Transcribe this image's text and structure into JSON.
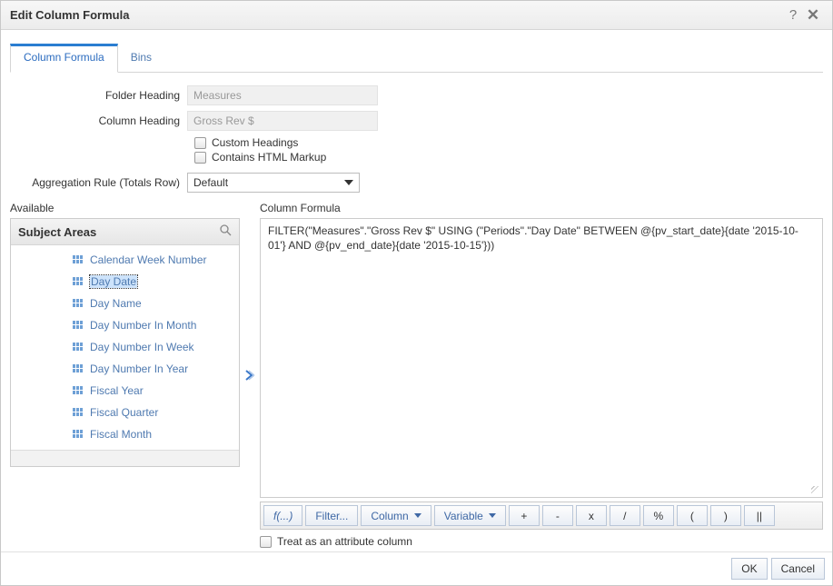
{
  "title": "Edit Column Formula",
  "tabs": [
    {
      "label": "Column Formula",
      "active": true
    },
    {
      "label": "Bins",
      "active": false
    }
  ],
  "form": {
    "folder_heading_label": "Folder Heading",
    "folder_heading_value": "Measures",
    "column_heading_label": "Column Heading",
    "column_heading_value": "Gross Rev $",
    "custom_headings_label": "Custom Headings",
    "contains_html_label": "Contains HTML Markup",
    "aggregation_label": "Aggregation Rule (Totals Row)",
    "aggregation_value": "Default"
  },
  "available_label": "Available",
  "subject_areas_label": "Subject Areas",
  "tree_items": [
    {
      "label": "Calendar Week Number",
      "selected": false
    },
    {
      "label": "Day Date",
      "selected": true
    },
    {
      "label": "Day Name",
      "selected": false
    },
    {
      "label": "Day Number In Month",
      "selected": false
    },
    {
      "label": "Day Number In Week",
      "selected": false
    },
    {
      "label": "Day Number In Year",
      "selected": false
    },
    {
      "label": "Fiscal Year",
      "selected": false
    },
    {
      "label": "Fiscal Quarter",
      "selected": false
    },
    {
      "label": "Fiscal Month",
      "selected": false
    }
  ],
  "column_formula_label": "Column Formula",
  "column_formula_value": "FILTER(\"Measures\".\"Gross Rev $\" USING (\"Periods\".\"Day Date\" BETWEEN @{pv_start_date}{date '2015-10-01'} AND @{pv_end_date}{date '2015-10-15'}))",
  "toolbar": {
    "fx": "f(...)",
    "filter": "Filter...",
    "column": "Column",
    "variable": "Variable",
    "plus": "+",
    "minus": "-",
    "mult": "x",
    "div": "/",
    "pct": "%",
    "lparen": "(",
    "rparen": ")",
    "concat": "||"
  },
  "treat_label": "Treat as an attribute column",
  "footer": {
    "ok": "OK",
    "cancel": "Cancel"
  }
}
